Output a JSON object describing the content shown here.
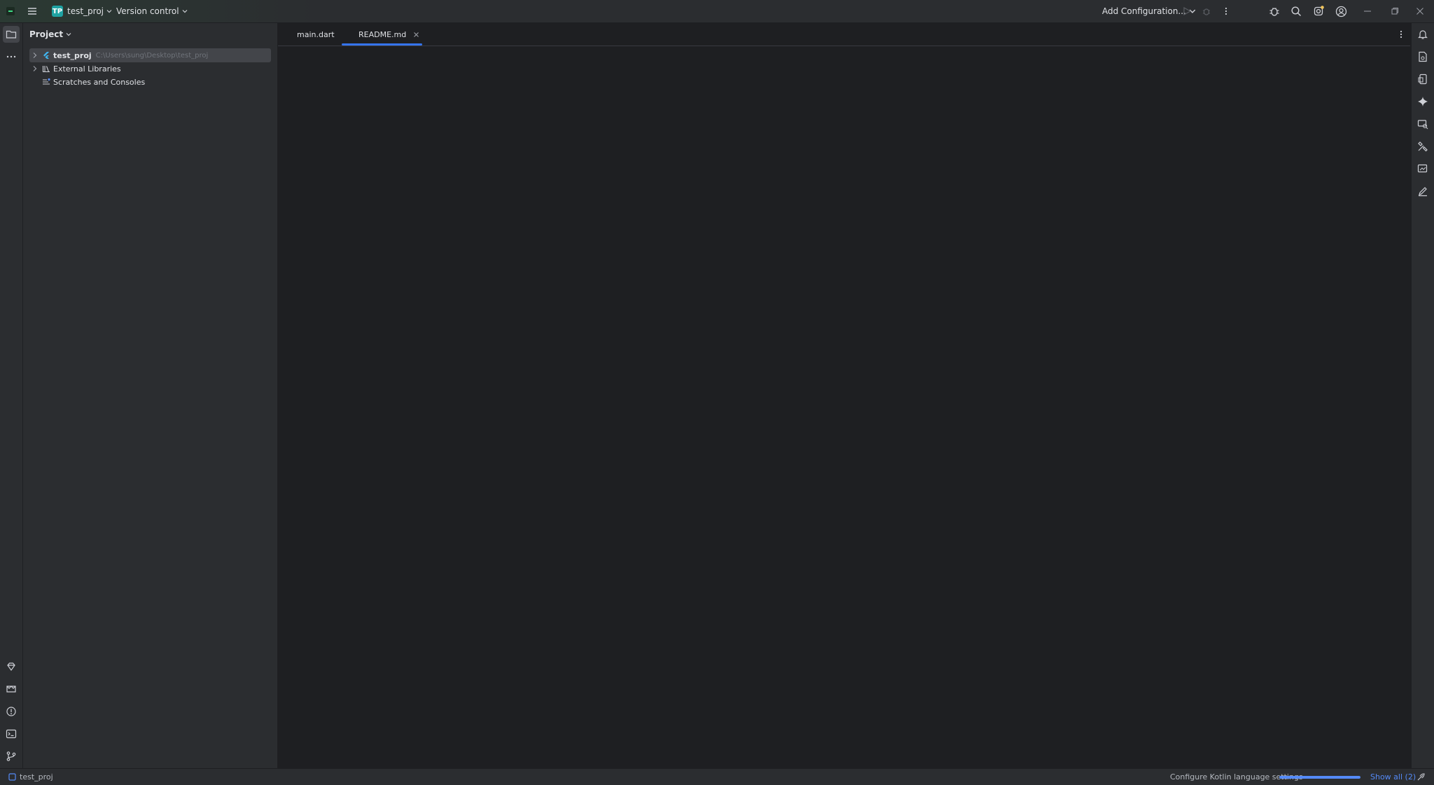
{
  "titlebar": {
    "project_badge": "TP",
    "project_name": "test_proj",
    "vcs_label": "Version control",
    "run_config_label": "Add Configuration..."
  },
  "project_panel": {
    "title": "Project",
    "tree": [
      {
        "label": "test_proj",
        "path": "C:\\Users\\sung\\Desktop\\test_proj",
        "icon": "flutter-module-icon",
        "expandable": true,
        "selected": true
      },
      {
        "label": "External Libraries",
        "icon": "library-icon",
        "expandable": true
      },
      {
        "label": "Scratches and Consoles",
        "icon": "scratches-icon",
        "expandable": false
      }
    ]
  },
  "editor": {
    "tabs": [
      {
        "label": "main.dart",
        "active": false
      },
      {
        "label": "README.md",
        "active": true,
        "closable": true
      }
    ]
  },
  "statusbar": {
    "project_label": "test_proj",
    "background_task": "Configure Kotlin language settings",
    "progress_fraction": 1.0,
    "show_all_label": "Show all (2)"
  },
  "colors": {
    "accent": "#3574f0",
    "panel_bg": "#2b2d30",
    "editor_bg": "#1e1f22",
    "badge": "#1fa3a3"
  }
}
